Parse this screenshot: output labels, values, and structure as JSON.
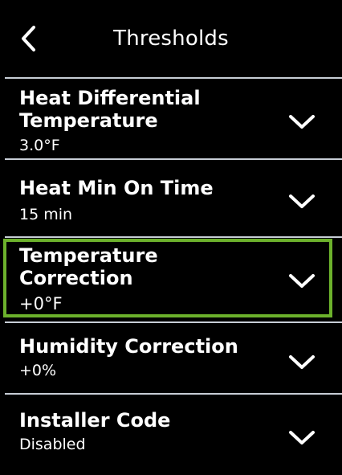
{
  "header": {
    "title": "Thresholds",
    "back_icon": "chevron-left-icon"
  },
  "settings": [
    {
      "label_line1": "Heat Differential",
      "label_line2": "Temperature",
      "value": "3.0°F",
      "expand_icon": "chevron-down-icon"
    },
    {
      "label_line1": "Heat Min On Time",
      "value": "15 min",
      "expand_icon": "chevron-down-icon"
    },
    {
      "label_line1": "Temperature",
      "label_line2": "Correction",
      "value": "+0°F",
      "expand_icon": "chevron-down-icon",
      "highlighted": true
    },
    {
      "label_line1": "Humidity Correction",
      "value": "+0%",
      "expand_icon": "chevron-down-icon"
    },
    {
      "label_line1": "Installer Code",
      "value": "Disabled",
      "expand_icon": "chevron-down-icon"
    }
  ],
  "colors": {
    "background": "#000000",
    "text": "#ffffff",
    "divider": "#c7cdd6",
    "highlight_border": "#6cb12c"
  }
}
